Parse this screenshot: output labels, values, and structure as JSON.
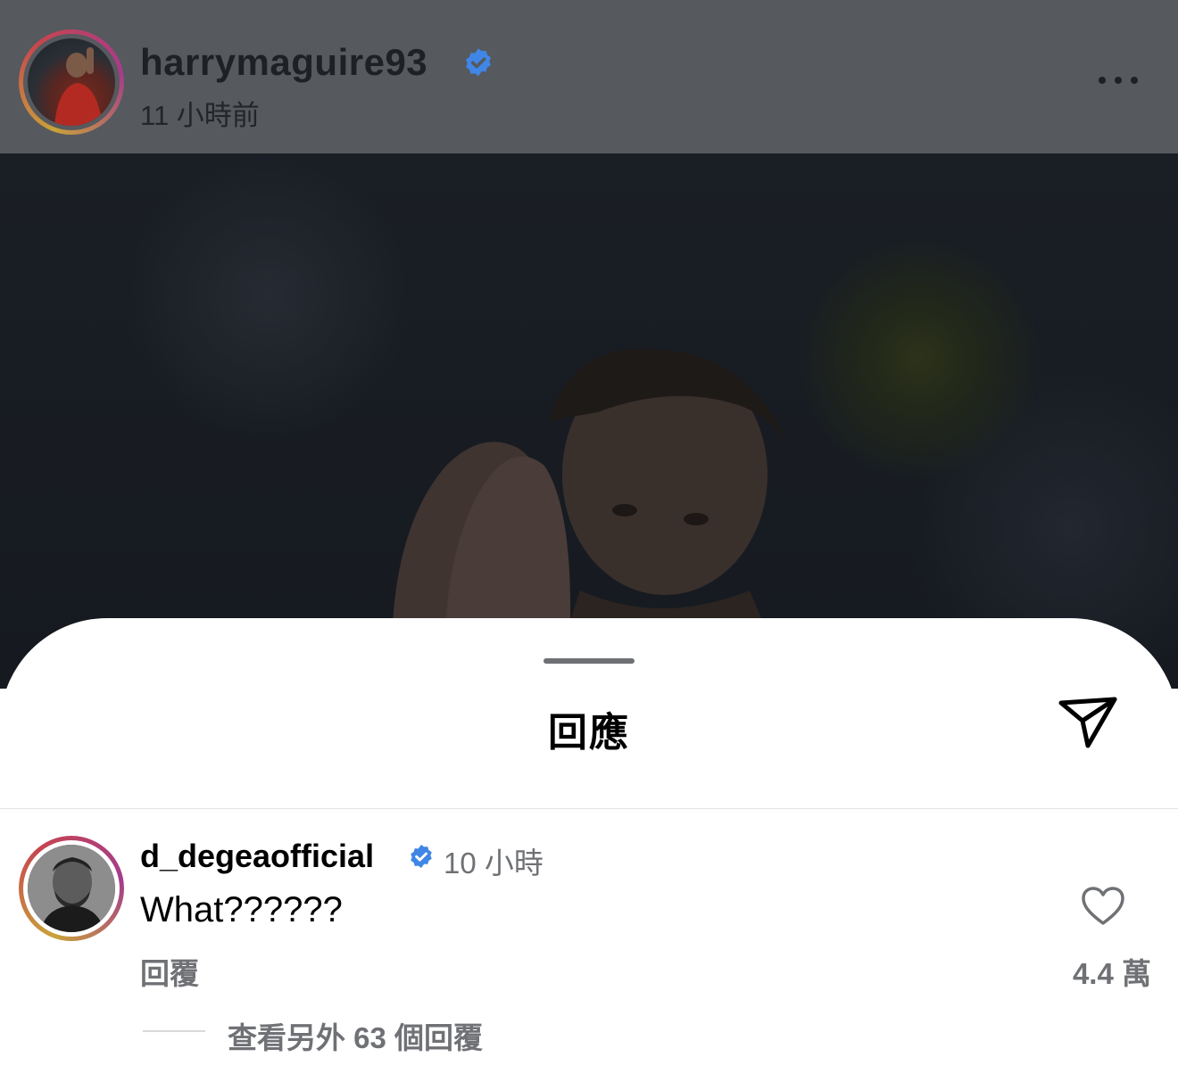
{
  "post": {
    "username": "harrymaguire93",
    "time": "11 小時前",
    "icons": {
      "verified": "verified-badge-icon",
      "more": "more-options-icon"
    }
  },
  "sheet": {
    "title": "回應",
    "share_icon": "share-send-icon"
  },
  "comment": {
    "username": "d_degeaofficial",
    "time": "10 小時",
    "text": "What??????",
    "reply_label": "回覆",
    "likes": "4.4 萬",
    "view_replies": "查看另外 63 個回覆",
    "heart_icon": "heart-icon"
  },
  "colors": {
    "verified_blue": "#3f86e6",
    "secondary_text": "#6f7175",
    "dim_overlay": "#56595d"
  }
}
